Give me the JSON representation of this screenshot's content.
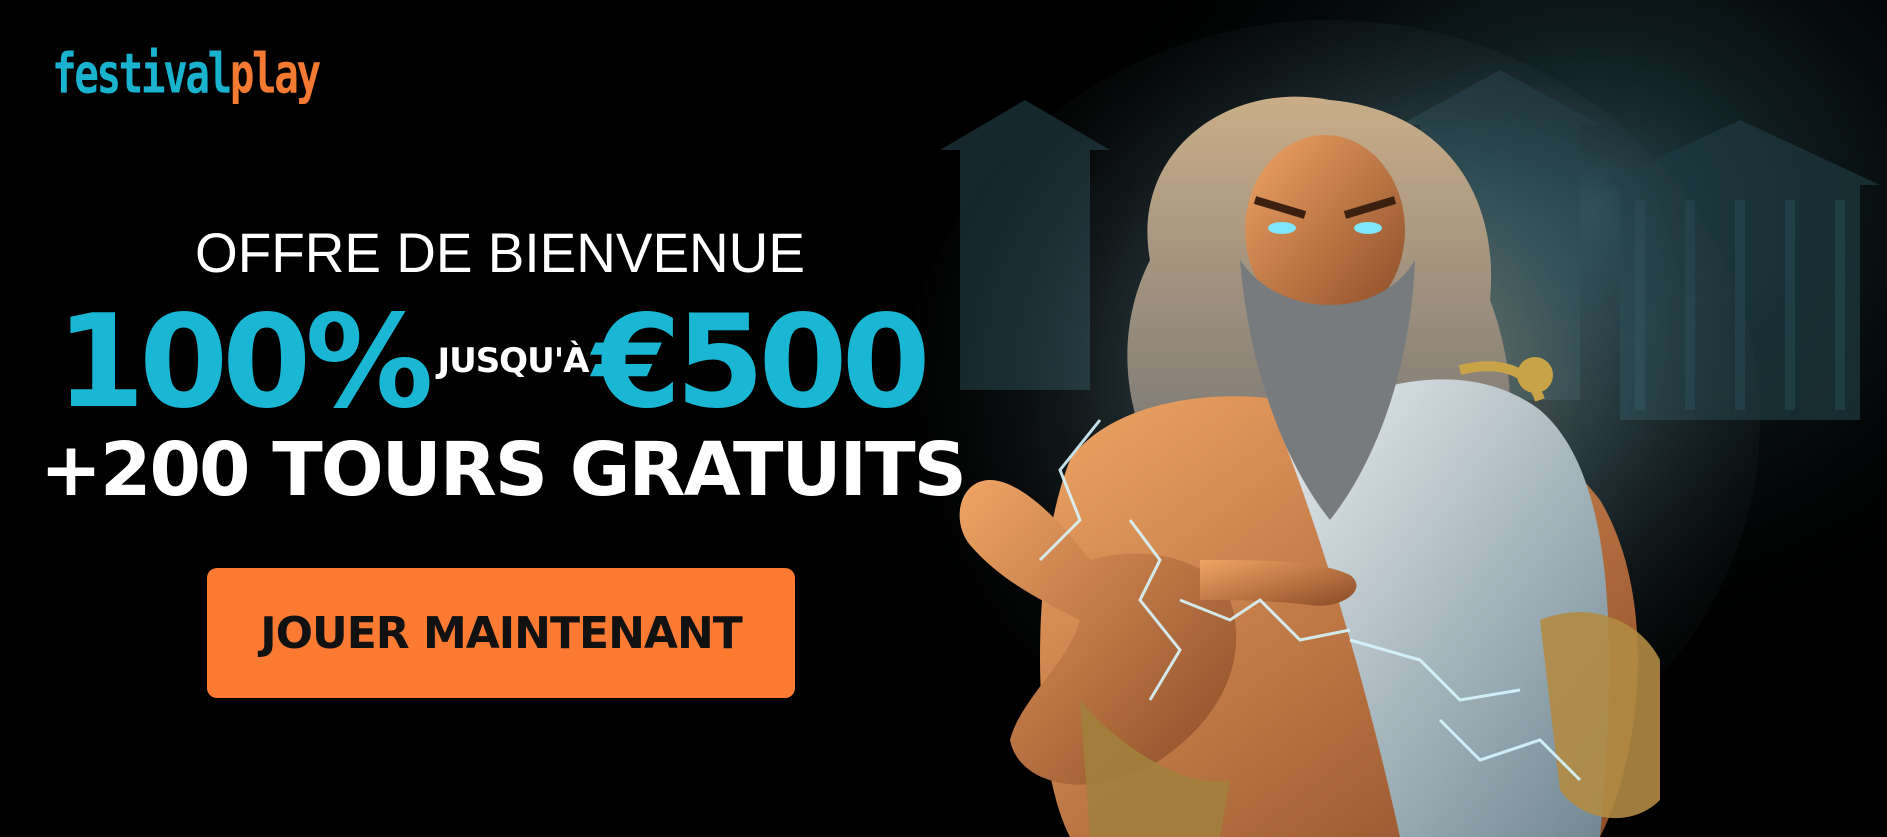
{
  "brand": {
    "logo_part_a": "festival",
    "logo_part_b": "play",
    "primary_color": "#1ab3cf",
    "accent_color": "#f47a32"
  },
  "offer": {
    "subtitle": "OFFRE DE BIENVENUE",
    "percent": "100%",
    "connector": "JUSQU'À",
    "amount": "€500",
    "extra": "+200 TOURS GRATUITS"
  },
  "cta": {
    "label": "JOUER MAINTENANT",
    "color": "#fd7a33"
  },
  "hero": {
    "icon": "zeus-lightning-illustration"
  }
}
